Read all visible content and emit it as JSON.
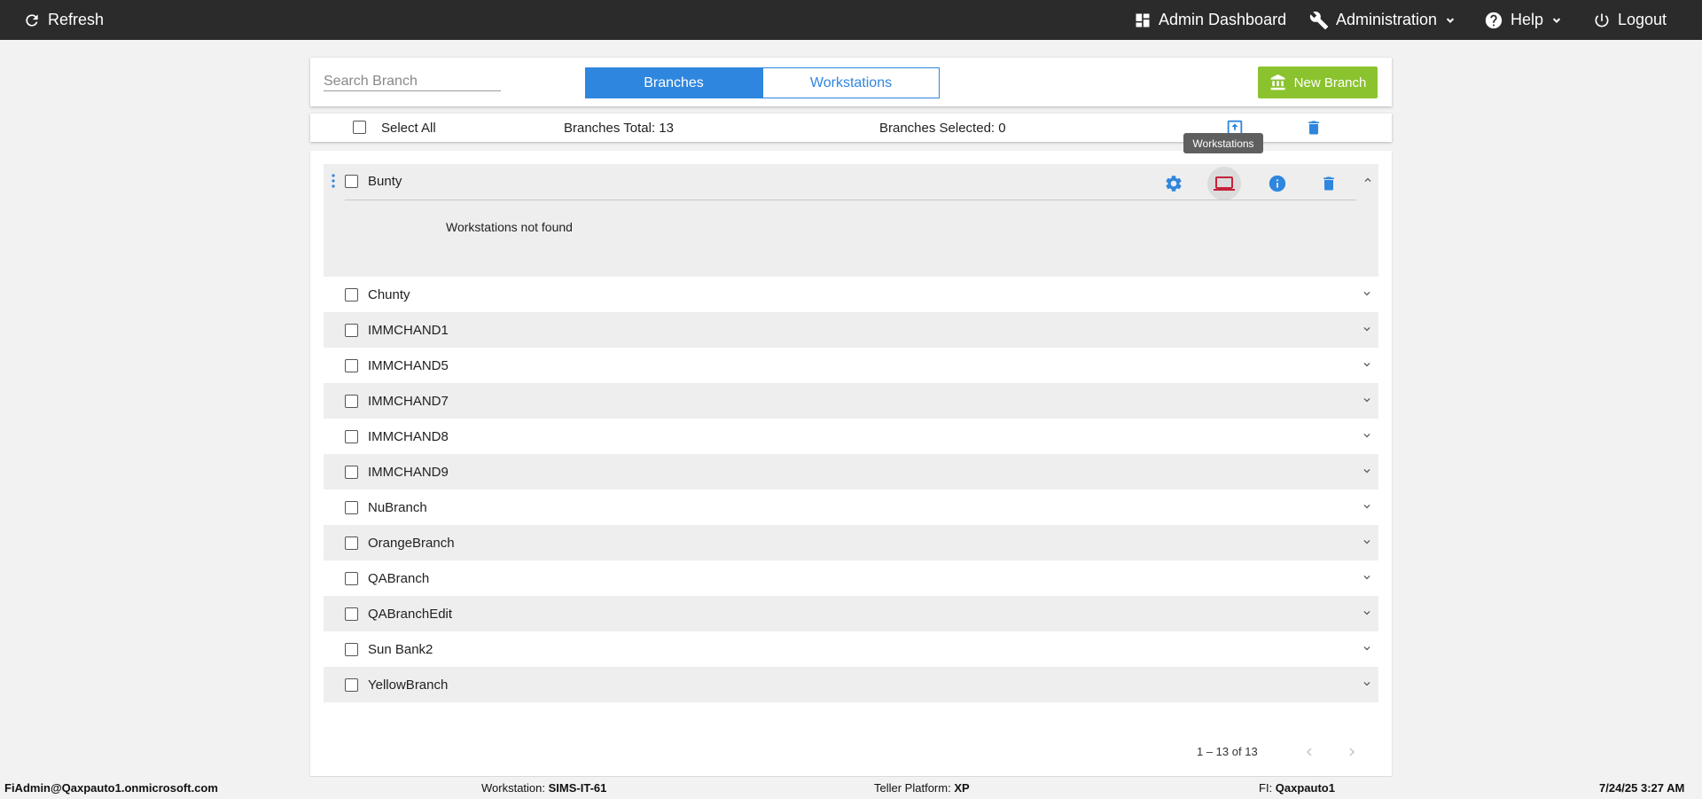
{
  "topbar": {
    "refresh_label": "Refresh",
    "admin_dashboard_label": "Admin Dashboard",
    "administration_label": "Administration",
    "help_label": "Help",
    "logout_label": "Logout",
    "background": "#2b2b2b"
  },
  "search": {
    "placeholder": "Search Branch",
    "value": ""
  },
  "tabs": {
    "branches_label": "Branches",
    "workstations_label": "Workstations",
    "active": "Branches"
  },
  "new_branch_label": "New Branch",
  "actions_bar": {
    "select_all_label": "Select All",
    "branches_total": "Branches Total: 13",
    "branches_selected": "Branches Selected: 0",
    "tooltip": "Workstations"
  },
  "expanded_branch": {
    "name": "Bunty",
    "message": "Workstations not found",
    "icons": [
      "settings-icon",
      "laptop-icon",
      "info-icon",
      "delete-icon",
      "chevron-up-icon"
    ]
  },
  "branches": [
    {
      "name": "Chunty"
    },
    {
      "name": "IMMCHAND1"
    },
    {
      "name": "IMMCHAND5"
    },
    {
      "name": "IMMCHAND7"
    },
    {
      "name": "IMMCHAND8"
    },
    {
      "name": "IMMCHAND9"
    },
    {
      "name": "NuBranch"
    },
    {
      "name": "OrangeBranch"
    },
    {
      "name": "QABranch"
    },
    {
      "name": "QABranchEdit"
    },
    {
      "name": "Sun Bank2"
    },
    {
      "name": "YellowBranch"
    }
  ],
  "pagination": {
    "range_label": "1 – 13 of 13"
  },
  "footer": {
    "user": "FiAdmin@Qaxpauto1.onmicrosoft.com",
    "workstation_label": "Workstation:",
    "workstation_value": "SIMS-IT-61",
    "platform_label": "Teller Platform:",
    "platform_value": "XP",
    "fi_label": "FI:",
    "fi_value": "Qaxpauto1",
    "datetime": "7/24/25 3:27 AM"
  },
  "colors": {
    "primary": "#2f86de",
    "success": "#8bc32f",
    "laptop_active": "#c6223a",
    "row_alt": "#eeeeee"
  }
}
